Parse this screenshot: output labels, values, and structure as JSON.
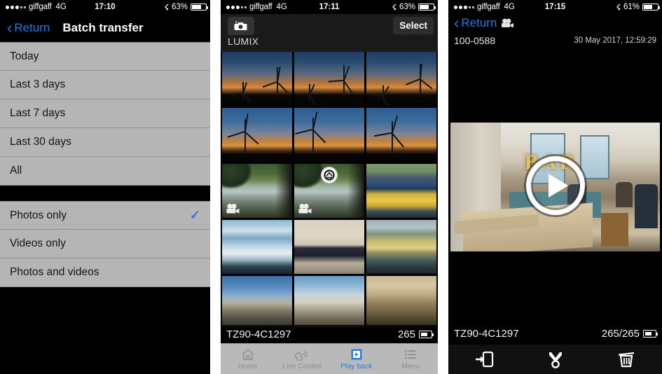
{
  "screens": [
    {
      "id": "batch-transfer",
      "status_bar": {
        "carrier": "giffgaff",
        "network": "4G",
        "time": "17:10",
        "bluetooth_icon": "bluetooth-icon",
        "battery_percent": "63%",
        "signal_filled_dots": 3,
        "signal_hollow_dots": 2
      },
      "nav": {
        "back_label": "Return",
        "back_icon": "chevron-left-icon",
        "title": "Batch transfer"
      },
      "date_options": [
        {
          "label": "Today",
          "selected": false
        },
        {
          "label": "Last 3 days",
          "selected": false
        },
        {
          "label": "Last 7 days",
          "selected": false
        },
        {
          "label": "Last 30 days",
          "selected": false
        },
        {
          "label": "All",
          "selected": false
        }
      ],
      "media_options": [
        {
          "label": "Photos only",
          "selected": true,
          "check_icon": "checkmark-icon"
        },
        {
          "label": "Videos only",
          "selected": false
        },
        {
          "label": "Photos and videos",
          "selected": false
        }
      ]
    },
    {
      "id": "lumix-playback",
      "status_bar": {
        "carrier": "giffgaff",
        "network": "4G",
        "time": "17:11",
        "bluetooth_icon": "bluetooth-icon",
        "battery_percent": "63%",
        "signal_filled_dots": 3,
        "signal_hollow_dots": 2
      },
      "header": {
        "camera_icon": "camera-icon",
        "brand_label": "LUMIX",
        "select_label": "Select"
      },
      "thumbnails": [
        {
          "name": "wind-turbines-dusk-1",
          "art": "t-turbine",
          "video": false,
          "transferring": false
        },
        {
          "name": "wind-turbines-dusk-2",
          "art": "t-turbine",
          "video": false,
          "transferring": false
        },
        {
          "name": "wind-turbines-dusk-3",
          "art": "t-turbine",
          "video": false,
          "transferring": false
        },
        {
          "name": "wind-turbine-dusk-4",
          "art": "t-turbine2",
          "video": false,
          "transferring": false
        },
        {
          "name": "wind-turbine-dusk-5",
          "art": "t-turbine2",
          "video": false,
          "transferring": false
        },
        {
          "name": "wind-turbine-dusk-6",
          "art": "t-turbine2",
          "video": false,
          "transferring": false
        },
        {
          "name": "lakeside-boats-1",
          "art": "t-lake",
          "video": true,
          "transferring": false
        },
        {
          "name": "lakeside-boats-2",
          "art": "t-lake",
          "video": true,
          "transferring": true
        },
        {
          "name": "yellow-boat-hull",
          "art": "t-yellowboat",
          "video": false,
          "transferring": false
        },
        {
          "name": "blue-motorboat",
          "art": "t-blueboat",
          "video": false,
          "transferring": false
        },
        {
          "name": "crow-on-ledge",
          "art": "t-crow",
          "video": false,
          "transferring": false
        },
        {
          "name": "sunken-wreck",
          "art": "t-wreck",
          "video": false,
          "transferring": false
        },
        {
          "name": "cathedral-tower",
          "art": "t-cathedral1",
          "video": false,
          "transferring": false
        },
        {
          "name": "cathedral-spires",
          "art": "t-cathedral2",
          "video": false,
          "transferring": false
        },
        {
          "name": "stone-carving",
          "art": "t-cathedral3",
          "video": false,
          "transferring": false
        }
      ],
      "camera_footer": {
        "device_name": "TZ90-4C1297",
        "count": "265",
        "battery_icon": "camera-battery-icon"
      },
      "tabs": [
        {
          "label": "Home",
          "icon": "home-icon",
          "active": false
        },
        {
          "label": "Live Control",
          "icon": "wifi-remote-icon",
          "active": false
        },
        {
          "label": "Play back",
          "icon": "play-square-icon",
          "active": true
        },
        {
          "label": "Menu",
          "icon": "list-menu-icon",
          "active": false
        }
      ],
      "accent_color": "#2b7ae4"
    },
    {
      "id": "video-viewer",
      "status_bar": {
        "carrier": "giffgaff",
        "network": "4G",
        "time": "17:15",
        "bluetooth_icon": "bluetooth-icon",
        "battery_percent": "61%",
        "signal_filled_dots": 3,
        "signal_hollow_dots": 2
      },
      "nav": {
        "back_label": "Return",
        "back_icon": "chevron-left-icon",
        "movie_icon": "movie-camera-icon"
      },
      "meta": {
        "file_id": "100-0588",
        "date": "30 May 2017, 12:59:29"
      },
      "video": {
        "scene_label": "BAR",
        "play_icon": "play-circle-icon"
      },
      "footer": {
        "device_name": "TZ90-4C1297",
        "count": "265/265",
        "battery_icon": "camera-battery-icon"
      },
      "toolbar": [
        {
          "label": "Save to phone",
          "icon": "save-to-phone-icon"
        },
        {
          "label": "Share",
          "icon": "share-fork-icon"
        },
        {
          "label": "Delete",
          "icon": "trash-icon"
        }
      ]
    }
  ]
}
